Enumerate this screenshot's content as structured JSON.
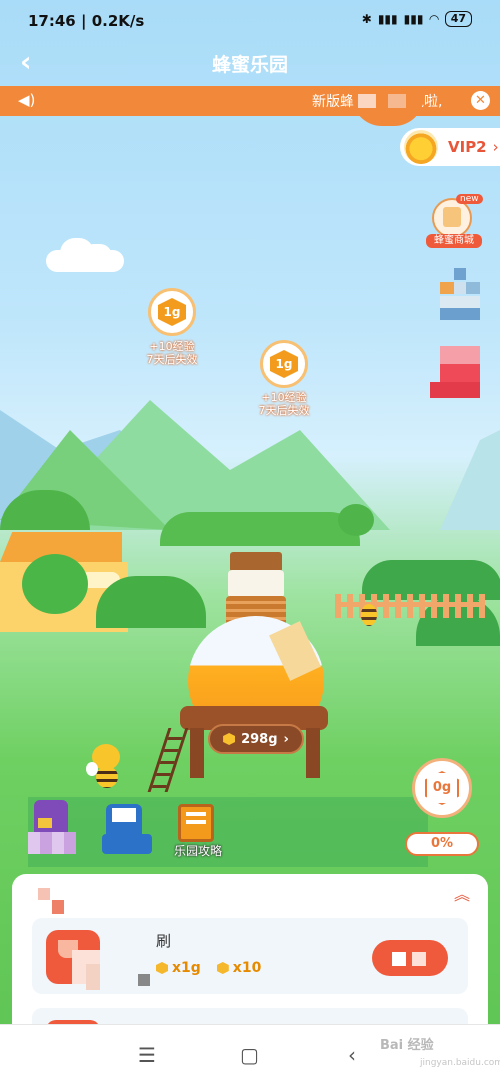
{
  "status_bar": {
    "time": "17:46",
    "speed": "0.2K/s",
    "battery": "47"
  },
  "header": {
    "title": "蜂蜜乐园",
    "back_icon": "chevron-left-icon"
  },
  "notice": {
    "text": "新版蜂蜜乐园上线啦,",
    "icon": "speaker-icon",
    "close_icon": "close-icon"
  },
  "vip": {
    "label": "VIP2"
  },
  "shop": {
    "badge": "new",
    "label": "蜂蜜商城"
  },
  "coins": [
    {
      "amount": "1g",
      "exp": "+10经验",
      "expire": "7天后失效"
    },
    {
      "amount": "1g",
      "exp": "+10经验",
      "expire": "7天后失效"
    }
  ],
  "pot": {
    "label": "298g"
  },
  "tools": [
    {
      "label": ""
    },
    {
      "label": ""
    },
    {
      "label": "乐园攻略"
    }
  ],
  "gauge": {
    "value": "0g",
    "percent": "0%"
  },
  "task": {
    "name": "刷",
    "reward_1": "x1g",
    "reward_2": "x10"
  },
  "nav": {
    "menu": "☰",
    "home": "▢",
    "back": "‹"
  },
  "watermark": {
    "brand": "Bai 经验",
    "url": "jingyan.baidu.com"
  }
}
